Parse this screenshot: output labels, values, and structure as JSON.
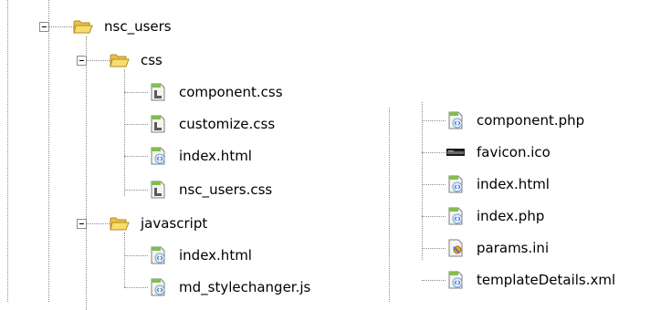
{
  "tree": {
    "root": {
      "label": "nsc_users",
      "icon": "open-folder-icon",
      "expanded": true
    },
    "css_folder": {
      "label": "css",
      "icon": "open-folder-icon",
      "expanded": true
    },
    "css_files": [
      {
        "label": "component.css",
        "icon": "css-file-icon"
      },
      {
        "label": "customize.css",
        "icon": "css-file-icon"
      },
      {
        "label": "index.html",
        "icon": "html-file-icon"
      },
      {
        "label": "nsc_users.css",
        "icon": "css-file-icon"
      }
    ],
    "javascript_folder": {
      "label": "javascript",
      "icon": "open-folder-icon",
      "expanded": true
    },
    "javascript_files": [
      {
        "label": "index.html",
        "icon": "html-file-icon"
      },
      {
        "label": "md_stylechanger.js",
        "icon": "js-file-icon"
      }
    ],
    "root_files": [
      {
        "label": "component.php",
        "icon": "php-file-icon"
      },
      {
        "label": "favicon.ico",
        "icon": "ico-file-icon"
      },
      {
        "label": "index.html",
        "icon": "html-file-icon"
      },
      {
        "label": "index.php",
        "icon": "php-file-icon"
      },
      {
        "label": "params.ini",
        "icon": "ini-file-icon"
      },
      {
        "label": "templateDetails.xml",
        "icon": "xml-file-icon"
      }
    ]
  },
  "colors": {
    "connector_line": "#8c8c8c",
    "folder_yellow": "#f5d860",
    "file_green": "#6a9a3a"
  }
}
